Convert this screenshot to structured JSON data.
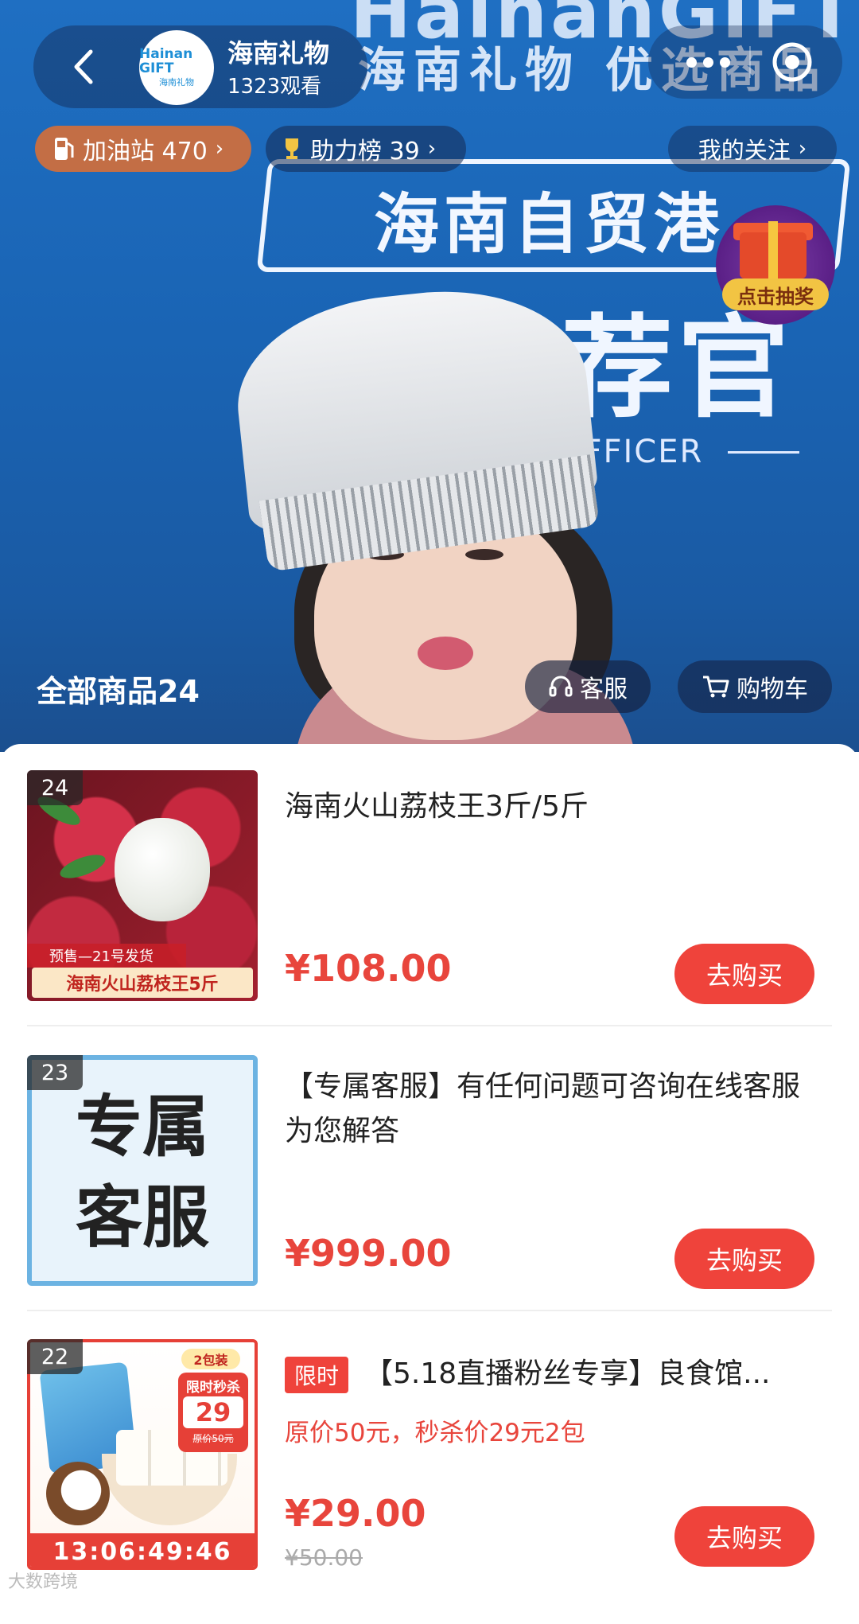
{
  "header": {
    "shop_name": "海南礼物",
    "viewers": "1323观看",
    "avatar_text_main": "Hainan GIFT",
    "avatar_text_sub": "海南礼物"
  },
  "pills": {
    "gas_station": "加油站 470",
    "help_rank": "助力榜 39",
    "my_follow": "我的关注"
  },
  "lottery": {
    "label": "点击抽奖"
  },
  "background_text": {
    "brand": "HainanGIFT",
    "brand_sub": "海南礼物 优选商品",
    "banner": "海南自贸港",
    "big": "推荐官",
    "officer": "OFFICER"
  },
  "goods_bar": {
    "all_goods": "全部商品24",
    "customer_service": "客服",
    "cart": "购物车"
  },
  "products": [
    {
      "num": "24",
      "title": "海南火山荔枝王3斤/5斤",
      "price": "¥108.00",
      "buy": "去购买",
      "thumb_presale": "预售—21号发货",
      "thumb_banner": "海南火山荔枝王5斤"
    },
    {
      "num": "23",
      "title": "【专属客服】有任何问题可咨询在线客服为您解答",
      "price": "¥999.00",
      "buy": "去购买",
      "thumb_line1": "专属",
      "thumb_line2": "客服"
    },
    {
      "num": "22",
      "limit_tag": "限时",
      "title": "【5.18直播粉丝专享】良食馆...",
      "subtitle": "原价50元，秒杀价29元2包",
      "price": "¥29.00",
      "orig_price": "¥50.00",
      "buy": "去购买",
      "thumb_pack": "2包装",
      "thumb_flash": "限时秒杀",
      "thumb_flash_price": "29",
      "thumb_flash_orig": "原价50元",
      "countdown": "13:06:49:46"
    }
  ],
  "watermark": "大数跨境"
}
